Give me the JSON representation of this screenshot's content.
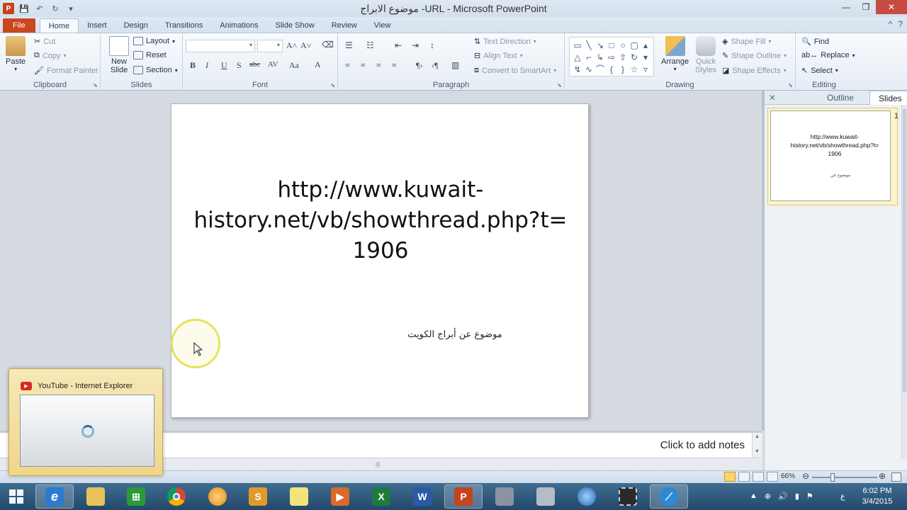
{
  "window": {
    "title": "موضوع الابراج -URL  -  Microsoft PowerPoint"
  },
  "ribbon": {
    "tabs": [
      "File",
      "Home",
      "Insert",
      "Design",
      "Transitions",
      "Animations",
      "Slide Show",
      "Review",
      "View"
    ],
    "clipboard": {
      "label": "Clipboard",
      "paste": "Paste",
      "cut": "Cut",
      "copy": "Copy",
      "format_painter": "Format Painter"
    },
    "slides": {
      "label": "Slides",
      "new_slide": "New Slide",
      "layout": "Layout",
      "reset": "Reset",
      "section": "Section"
    },
    "font": {
      "label": "Font"
    },
    "paragraph": {
      "label": "Paragraph",
      "text_direction": "Text Direction",
      "align_text": "Align Text",
      "convert_smartart": "Convert to SmartArt"
    },
    "drawing": {
      "label": "Drawing",
      "arrange": "Arrange",
      "quick_styles": "Quick Styles",
      "shape_fill": "Shape Fill",
      "shape_outline": "Shape Outline",
      "shape_effects": "Shape Effects"
    },
    "editing": {
      "label": "Editing",
      "find": "Find",
      "replace": "Replace",
      "select": "Select"
    }
  },
  "slide": {
    "title_lines": [
      "http://www.kuwait-",
      "history.net/vb/showthread.php?t=",
      "1906"
    ],
    "subtitle": "موضوع عن أبراج الكويت"
  },
  "side_pane": {
    "tabs": [
      "Outline",
      "Slides"
    ],
    "thumb_number": "1",
    "thumb_lines": [
      "http://www.kuwait-",
      "history.net/vb/showthread.php?t=",
      "1906"
    ],
    "thumb_sub": "موضوع عن"
  },
  "notes": {
    "placeholder": "Click to add notes"
  },
  "status": {
    "zoom": "66%"
  },
  "popup": {
    "title": "YouTube - Internet Explorer"
  },
  "taskbar": {
    "time": "6:02 PM",
    "date": "3/4/2015",
    "lang": "ع"
  }
}
